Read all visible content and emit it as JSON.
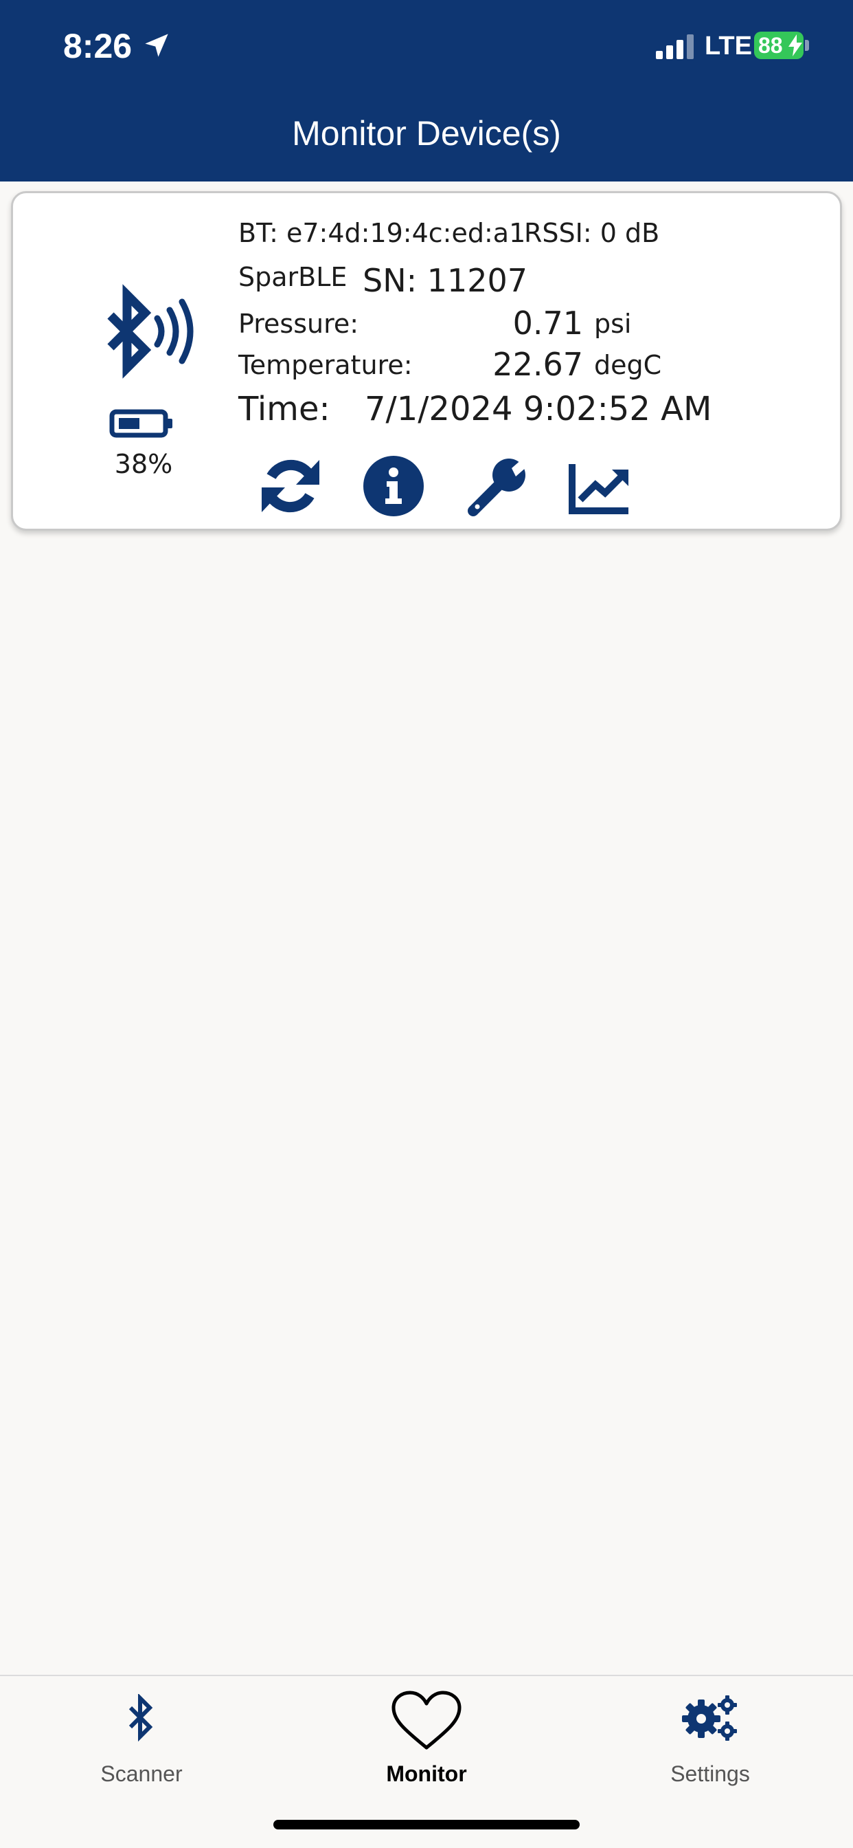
{
  "status_bar": {
    "time": "8:26",
    "network": "LTE",
    "battery": "88"
  },
  "header": {
    "title": "Monitor Device(s)"
  },
  "device": {
    "bt_address": "BT: e7:4d:19:4c:ed:a1",
    "rssi": "RSSI: 0 dB",
    "name": "SparBLE",
    "serial": "SN: 11207",
    "pressure_label": "Pressure:",
    "pressure_value": "0.71",
    "pressure_unit": "psi",
    "temperature_label": "Temperature:",
    "temperature_value": "22.67",
    "temperature_unit": "degC",
    "time_label": "Time:",
    "time_value": "7/1/2024 9:02:52 AM",
    "battery_percent": "38%"
  },
  "actions": [
    {
      "icon": "refresh-icon"
    },
    {
      "icon": "info-icon"
    },
    {
      "icon": "wrench-icon"
    },
    {
      "icon": "chart-icon"
    }
  ],
  "tabs": [
    {
      "label": "Scanner",
      "icon": "bluetooth-icon",
      "active": false
    },
    {
      "label": "Monitor",
      "icon": "heart-icon",
      "active": true
    },
    {
      "label": "Settings",
      "icon": "gears-icon",
      "active": false
    }
  ],
  "colors": {
    "brand": "#0e3672",
    "background": "#f9f8f6",
    "battery_green": "#34c759"
  }
}
